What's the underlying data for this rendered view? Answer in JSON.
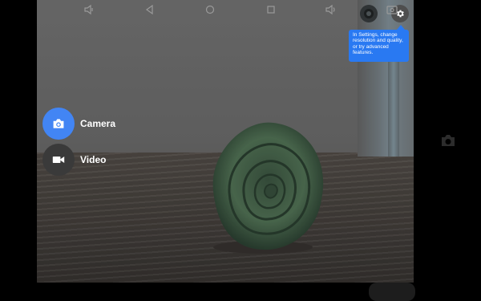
{
  "modes": {
    "camera_label": "Camera",
    "video_label": "Video"
  },
  "tooltip": {
    "text": "In Settings, change resolution and quality, or try advanced features."
  },
  "icons": {
    "settings": "gear-icon",
    "lens": "lens-icon",
    "camera": "camera-icon",
    "video": "videocam-icon",
    "shutter": "camera-icon",
    "nav": [
      "volume-down-icon",
      "back-icon",
      "home-icon",
      "recents-icon",
      "volume-up-icon",
      "screenshot-icon"
    ]
  },
  "colors": {
    "accent": "#4285f4",
    "tooltip": "#2979f2",
    "video_button": "#3a3a3a"
  }
}
